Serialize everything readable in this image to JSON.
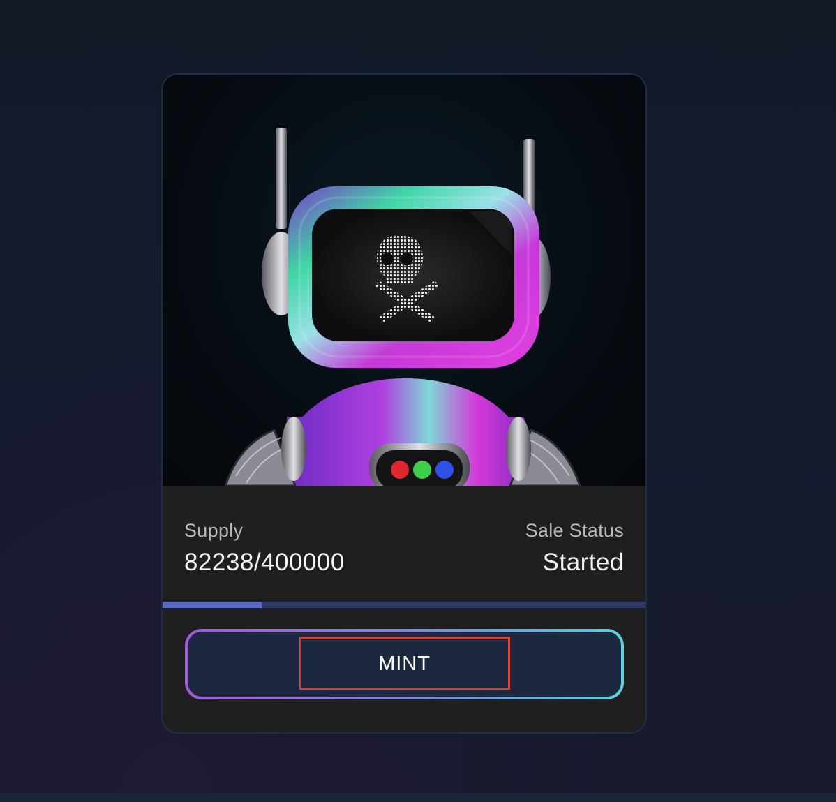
{
  "card": {
    "artwork_icon": "robot-artwork-icon",
    "supply_label": "Supply",
    "supply_value": "82238/400000",
    "status_label": "Sale Status",
    "status_value": "Started",
    "progress_fraction": 0.2056,
    "mint_label": "MINT"
  },
  "colors": {
    "background": "#131a2a",
    "card_background": "#1f1f1f",
    "progress_fill": "#5a6bc4",
    "progress_track": "#2f3a66",
    "mint_gradient_start": "#a25ad6",
    "mint_gradient_end": "#5fd1e0",
    "highlight_border": "#d6402f"
  }
}
